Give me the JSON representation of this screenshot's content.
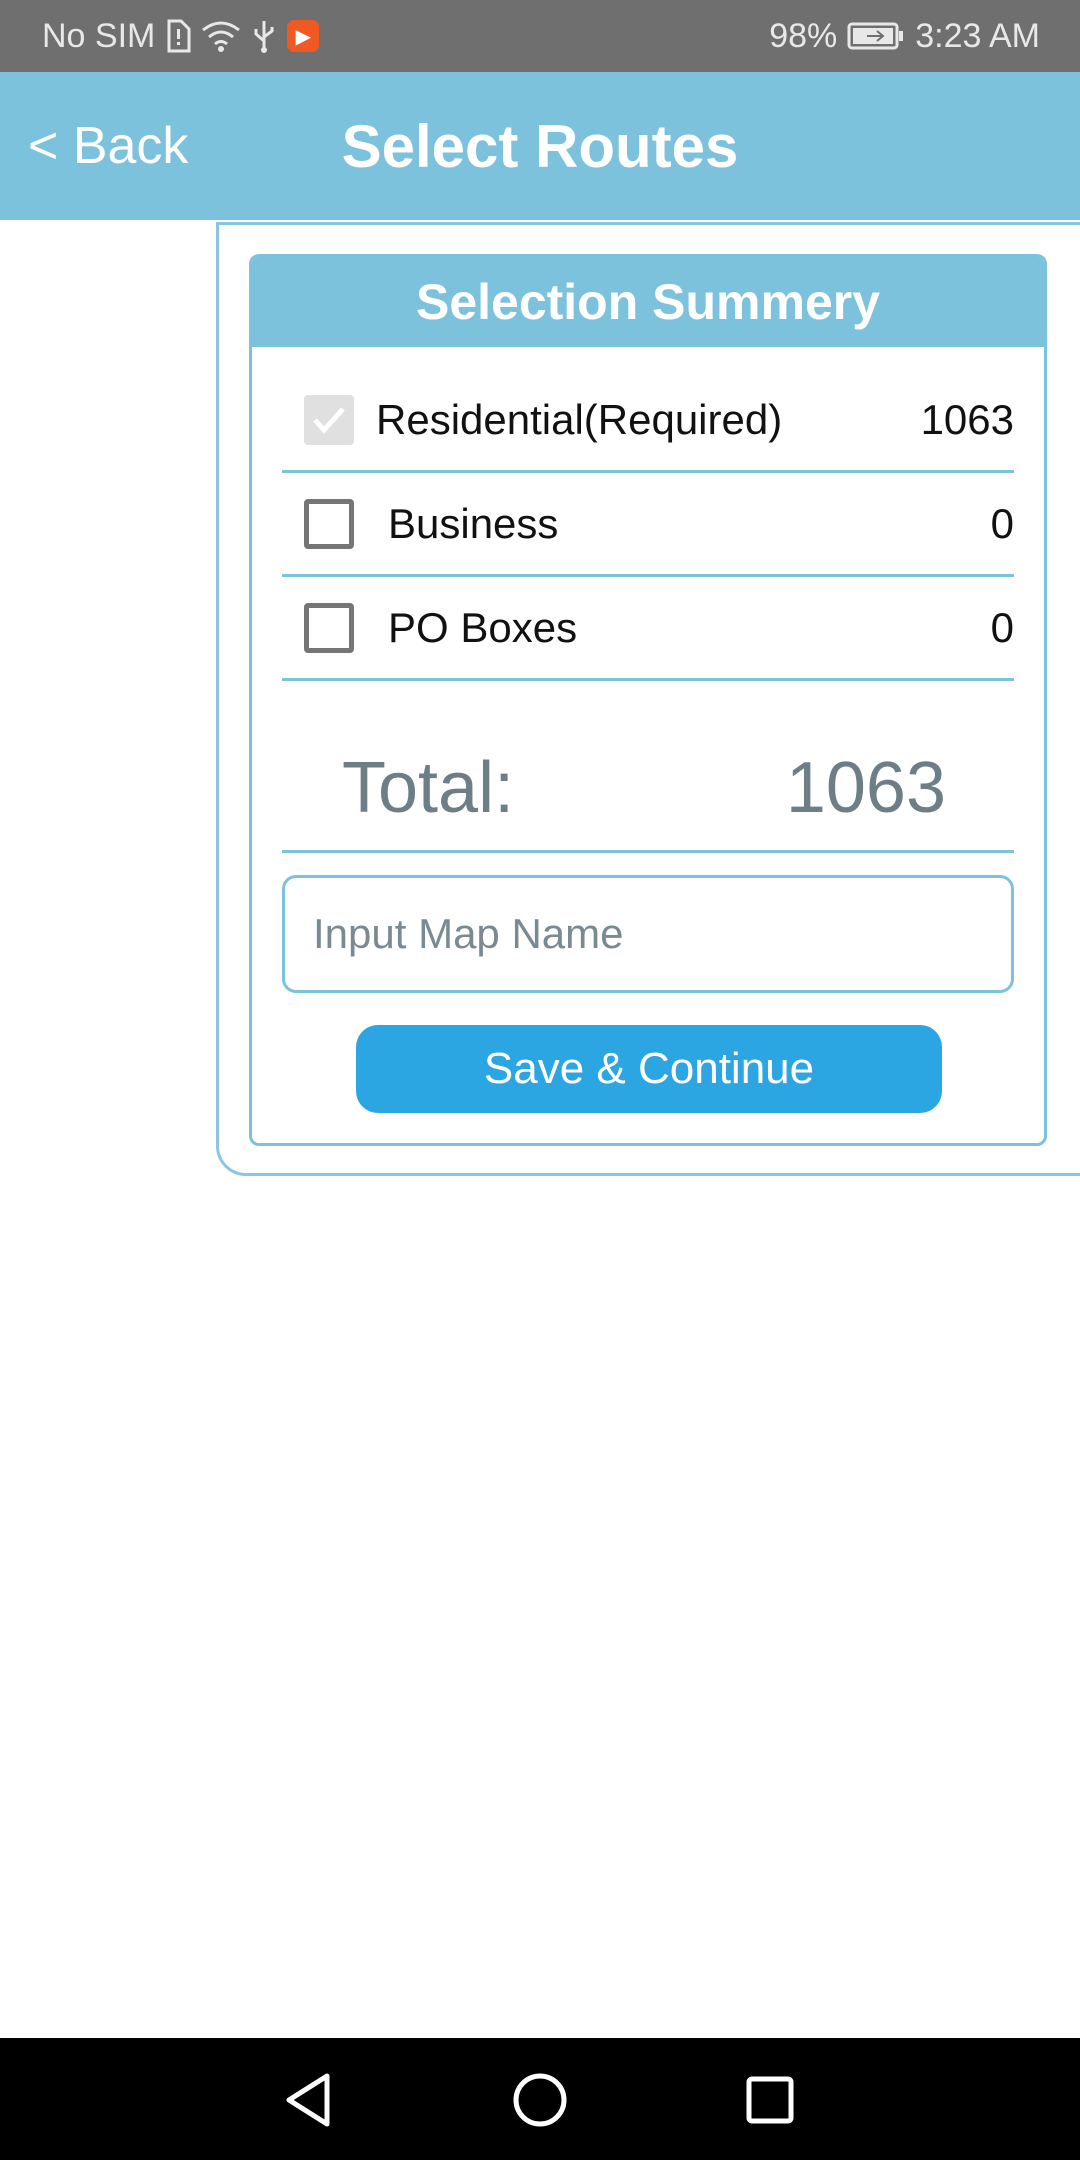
{
  "status_bar": {
    "carrier": "No SIM",
    "battery": "98%",
    "time": "3:23 AM",
    "icons": [
      "sim-alert-icon",
      "wifi-icon",
      "usb-icon",
      "app-notification-icon",
      "battery-charging-icon"
    ]
  },
  "header": {
    "back_label": "< Back",
    "title": "Select Routes",
    "color": "#7cc2dc"
  },
  "summary": {
    "title": "Selection Summery",
    "rows": [
      {
        "label": "Residential(Required)",
        "value": "1063",
        "checked": true,
        "disabled": true
      },
      {
        "label": "Business",
        "value": "0",
        "checked": false
      },
      {
        "label": "PO Boxes",
        "value": "0",
        "checked": false
      }
    ],
    "total_label": "Total:",
    "total_value": "1063",
    "map_name_placeholder": "Input Map Name",
    "save_label": "Save & Continue",
    "save_color": "#2ca6e2"
  },
  "nav_bar": {
    "icons": [
      "back-triangle-icon",
      "home-circle-icon",
      "recents-square-icon"
    ]
  }
}
